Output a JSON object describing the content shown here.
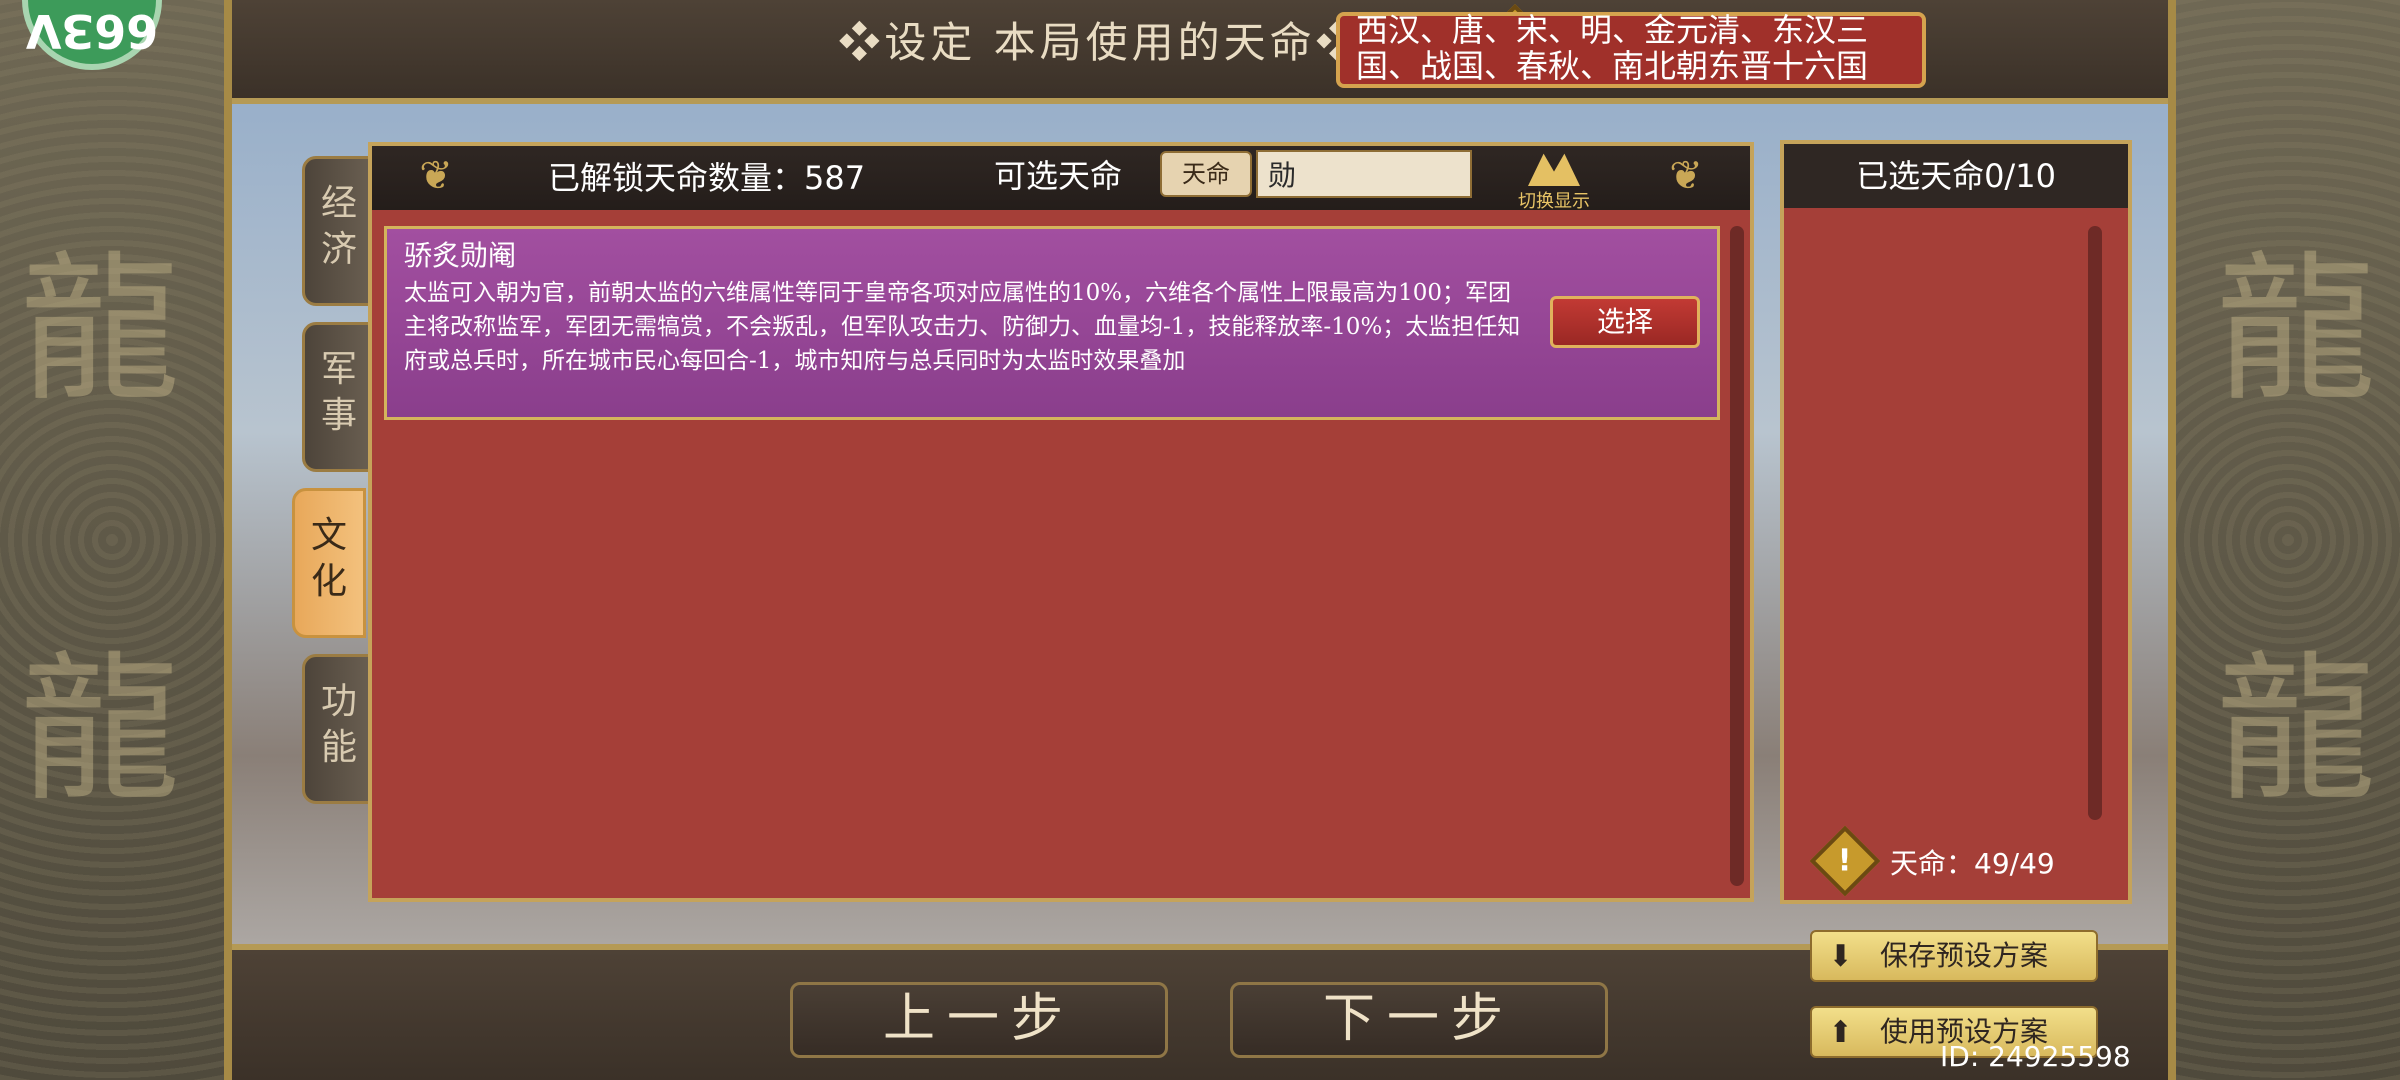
{
  "top": {
    "title": "❖设定 本局使用的天命❖",
    "dynasties": "西汉、唐、宋、明、金元清、东汉三国、战国、春秋、南北朝东晋十六国"
  },
  "logo": {
    "text": "66ЗV"
  },
  "tabs": [
    {
      "label": "经济"
    },
    {
      "label": "军事"
    },
    {
      "label": "文化"
    },
    {
      "label": "功能"
    }
  ],
  "header": {
    "unlocked_label": "已解锁天命数量：587",
    "selectable_label": "可选天命",
    "filter_tag": "天命",
    "search_value": "勋",
    "toggle_label": "切换显示"
  },
  "card": {
    "title": "骄炙勋阉",
    "description": "太监可入朝为官，前朝太监的六维属性等同于皇帝各项对应属性的10%，六维各个属性上限最高为100；军团主将改称监军，军团无需犒赏，不会叛乱，但军队攻击力、防御力、血量均-1，技能释放率-10%；太监担任知府或总兵时，所在城市民心每回合-1，城市知府与总兵同时为太监时效果叠加",
    "select_label": "选择"
  },
  "right_panel": {
    "header": "已选天命0/10",
    "quota": "天命：49/49"
  },
  "bottom": {
    "prev_label": "上一步",
    "next_label": "下一步",
    "save_preset": "保存预设方案",
    "use_preset": "使用预设方案"
  },
  "watermark": "ID: 24925598",
  "colors": {
    "panel_red": "#a53f38",
    "card_purple": "#a24fa0",
    "gold_border": "#c5a35a",
    "dark_header": "#2f2723"
  }
}
